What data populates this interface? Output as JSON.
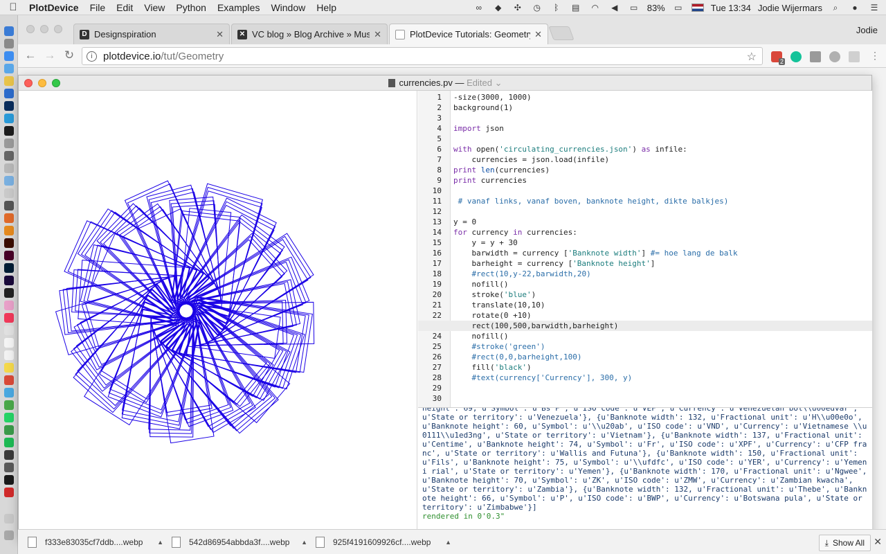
{
  "menubar": {
    "app": "PlotDevice",
    "items": [
      "File",
      "Edit",
      "View",
      "Python",
      "Examples",
      "Window",
      "Help"
    ],
    "battery": "83%",
    "clock": "Tue 13:34",
    "user": "Jodie Wijermars"
  },
  "browser": {
    "tabs": [
      {
        "title": "Designspiration",
        "favicon": "D"
      },
      {
        "title": "VC blog » Blog Archive » Musi",
        "favicon": "V"
      },
      {
        "title": "PlotDevice Tutorials: Geometry",
        "favicon": ""
      }
    ],
    "profile": "Jodie",
    "url_host": "plotdevice.io",
    "url_path": "/tut/Geometry",
    "ext_badge": "2"
  },
  "plotdevice": {
    "filename": "currencies.pv",
    "separator": " — ",
    "status": "Edited",
    "code_lines": [
      "-size(3000, 1000)",
      "background(1)",
      "",
      "import json",
      "",
      "with open('circulating_currencies.json') as infile:",
      "    currencies = json.load(infile)",
      "print len(currencies)",
      "print currencies",
      "",
      " # vanaf links, vanaf boven, banknote height, dikte balkjes)",
      "",
      "y = 0",
      "for currency in currencies:",
      "    y = y + 30",
      "    barwidth = currency ['Banknote width'] #= hoe lang de balk",
      "    barheight = currency ['Banknote height']",
      "    #rect(10,y-22,barwidth,20)",
      "    nofill()",
      "    stroke('blue')",
      "    translate(10,10)",
      "    rotate(0 +10)",
      "    rect(100,500,barwidth,barheight)",
      "    nofill()",
      "    #stroke('green')",
      "    #rect(0,0,barheight,100)",
      "    fill('black')",
      "    #text(currency['Currency'], 300, y)",
      "",
      ""
    ],
    "highlighted_line": 23,
    "console_text": "height': 69, u'Symbol': u'Bs F', u'ISO code': u'VEF', u'Currency': u'Venezuelan bol\\\\u00edvar', u'State or territory': u'Venezuela'}, {u'Banknote width': 132, u'Fractional unit': u'H\\\\u00e0o', u'Banknote height': 60, u'Symbol': u'\\\\u20ab', u'ISO code': u'VND', u'Currency': u'Vietnamese \\\\u0111\\\\u1ed3ng', u'State or territory': u'Vietnam'}, {u'Banknote width': 137, u'Fractional unit': u'Centime', u'Banknote height': 74, u'Symbol': u'Fr', u'ISO code': u'XPF', u'Currency': u'CFP franc', u'State or territory': u'Wallis and Futuna'}, {u'Banknote width': 150, u'Fractional unit': u'Fils', u'Banknote height': 75, u'Symbol': u'\\\\ufdfc', u'ISO code': u'YER', u'Currency': u'Yemeni rial', u'State or territory': u'Yemen'}, {u'Banknote width': 170, u'Fractional unit': u'Ngwee', u'Banknote height': 70, u'Symbol': u'ZK', u'ISO code': u'ZMW', u'Currency': u'Zambian kwacha', u'State or territory': u'Zambia'}, {u'Banknote width': 132, u'Fractional unit': u'Thebe', u'Banknote height': 66, u'Symbol': u'P', u'ISO code': u'BWP', u'Currency': u'Botswana pula', u'State or territory': u'Zimbabwe'}]",
    "console_done": "rendered in 0'0.3\"",
    "stroke_color": "#1a00e6"
  },
  "downloads": {
    "items": [
      "f333e83035cf7ddb....webp",
      "542d86954abbda3f....webp",
      "925f4191609926cf....webp"
    ],
    "show_all": "Show All"
  }
}
